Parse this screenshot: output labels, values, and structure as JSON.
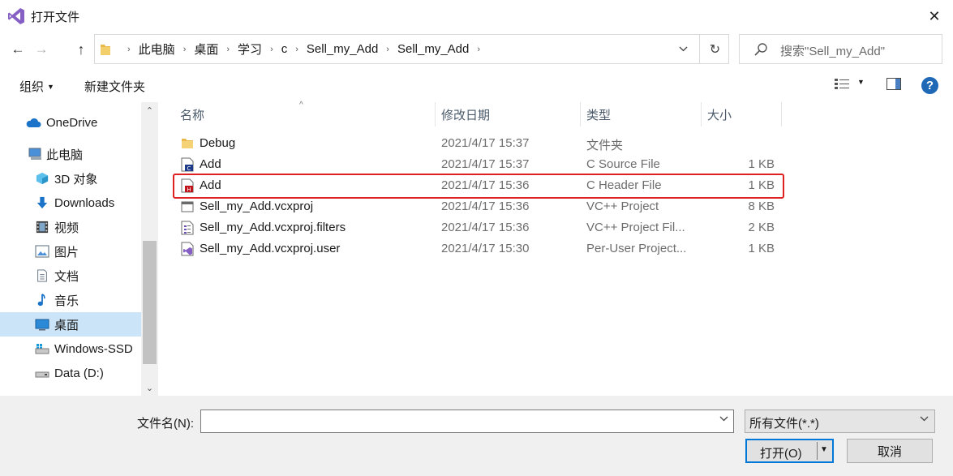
{
  "window": {
    "title": "打开文件",
    "close_glyph": "✕",
    "icon": "visual-studio-logo"
  },
  "nav": {
    "back": "←",
    "forward": "→",
    "up": "↑",
    "refresh": "↻",
    "dropdown": "⌄"
  },
  "breadcrumbs": [
    "此电脑",
    "桌面",
    "学习",
    "c",
    "Sell_my_Add",
    "Sell_my_Add"
  ],
  "search": {
    "placeholder": "搜索\"Sell_my_Add\""
  },
  "toolbar": {
    "organize": "组织",
    "new_folder": "新建文件夹",
    "help": "?"
  },
  "sidebar": {
    "items": [
      {
        "label": "OneDrive",
        "icon": "cloud-icon"
      },
      {
        "label": "此电脑",
        "icon": "computer-icon"
      },
      {
        "label": "3D 对象",
        "icon": "cube-icon"
      },
      {
        "label": "Downloads",
        "icon": "download-icon"
      },
      {
        "label": "视频",
        "icon": "video-icon"
      },
      {
        "label": "图片",
        "icon": "picture-icon"
      },
      {
        "label": "文档",
        "icon": "document-icon"
      },
      {
        "label": "音乐",
        "icon": "music-icon"
      },
      {
        "label": "桌面",
        "icon": "desktop-icon",
        "selected": true
      },
      {
        "label": "Windows-SSD",
        "icon": "drive-icon"
      },
      {
        "label": "Data (D:)",
        "icon": "drive-icon"
      }
    ]
  },
  "filelist": {
    "columns": {
      "name": "名称",
      "date": "修改日期",
      "type": "类型",
      "size": "大小"
    },
    "rows": [
      {
        "name": "Debug",
        "date": "2021/4/17 15:37",
        "type": "文件夹",
        "size": "",
        "icon": "folder-icon"
      },
      {
        "name": "Add",
        "date": "2021/4/17 15:37",
        "type": "C Source File",
        "size": "1 KB",
        "icon": "c-source-icon"
      },
      {
        "name": "Add",
        "date": "2021/4/17 15:36",
        "type": "C Header File",
        "size": "1 KB",
        "icon": "c-header-icon",
        "highlighted": true
      },
      {
        "name": "Sell_my_Add.vcxproj",
        "date": "2021/4/17 15:36",
        "type": "VC++ Project",
        "size": "8 KB",
        "icon": "vcxproj-icon"
      },
      {
        "name": "Sell_my_Add.vcxproj.filters",
        "date": "2021/4/17 15:36",
        "type": "VC++ Project Fil...",
        "size": "2 KB",
        "icon": "filters-icon"
      },
      {
        "name": "Sell_my_Add.vcxproj.user",
        "date": "2021/4/17 15:30",
        "type": "Per-User Project...",
        "size": "1 KB",
        "icon": "vs-user-icon"
      }
    ]
  },
  "bottom": {
    "filename_label": "文件名(N):",
    "filename_value": "",
    "filter_value": "所有文件(*.*)",
    "open_label": "打开(O)",
    "cancel_label": "取消"
  },
  "colors": {
    "highlight_border": "#e02020",
    "selected_bg": "#cce4f7",
    "accent": "#0078d7"
  }
}
